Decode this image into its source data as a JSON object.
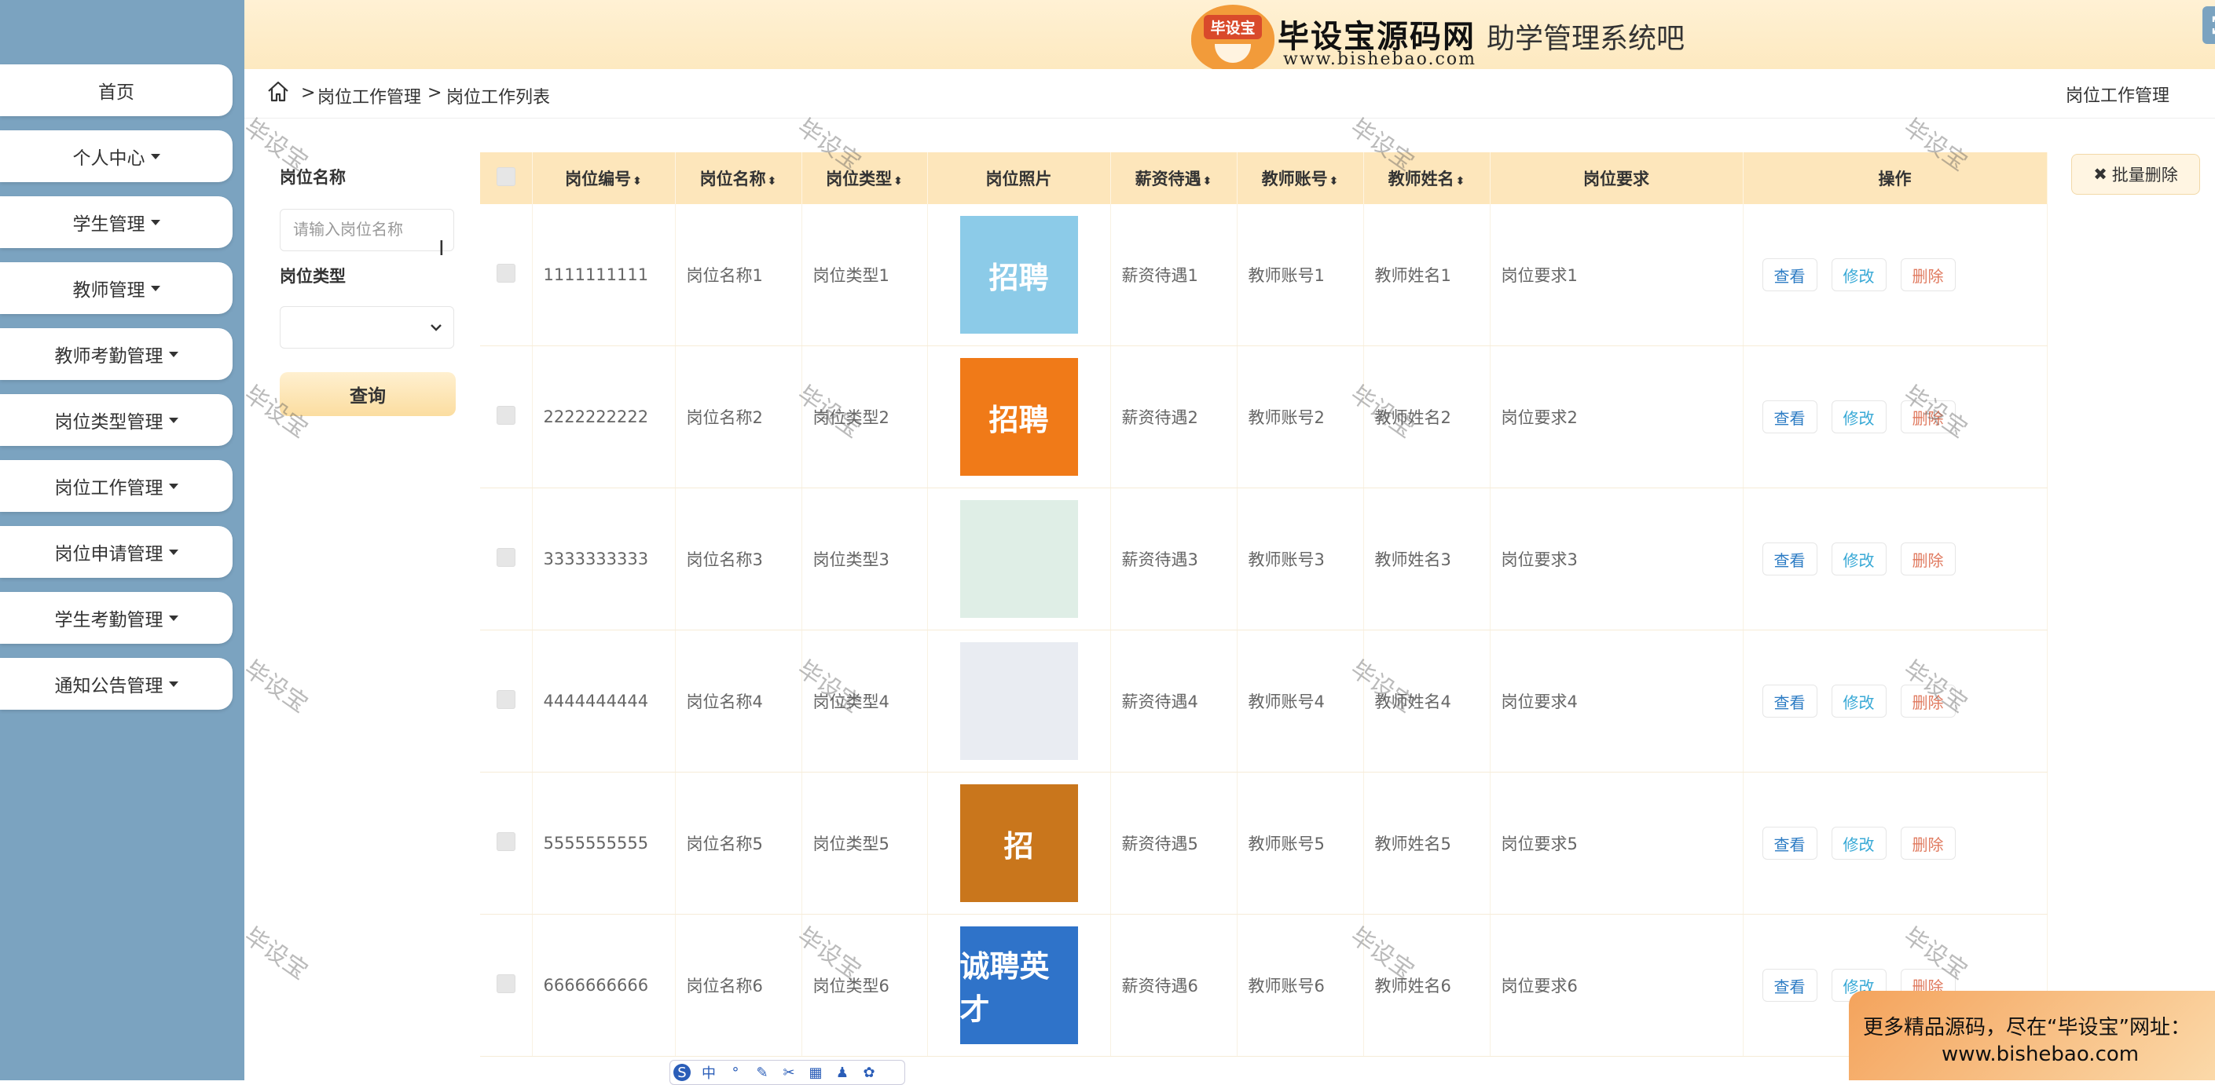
{
  "sidebar": {
    "items": [
      {
        "label": "首页",
        "caret": false
      },
      {
        "label": "个人中心",
        "caret": true
      },
      {
        "label": "学生管理",
        "caret": true
      },
      {
        "label": "教师管理",
        "caret": true
      },
      {
        "label": "教师考勤管理",
        "caret": true
      },
      {
        "label": "岗位类型管理",
        "caret": true
      },
      {
        "label": "岗位工作管理",
        "caret": true
      },
      {
        "label": "岗位申请管理",
        "caret": true
      },
      {
        "label": "学生考勤管理",
        "caret": true
      },
      {
        "label": "通知公告管理",
        "caret": true
      }
    ]
  },
  "header": {
    "logo_badge": "毕设宝",
    "logo_text": "毕设宝源码网",
    "logo_url": "www.bishebao.com",
    "system_title": "助学管理系统吧"
  },
  "breadcrumb": {
    "items": [
      "岗位工作管理",
      "岗位工作列表"
    ],
    "separator": ">",
    "right_title": "岗位工作管理"
  },
  "search": {
    "name_label": "岗位名称",
    "name_placeholder": "请输入岗位名称",
    "type_label": "岗位类型",
    "type_value": "",
    "query_button": "查询"
  },
  "actions": {
    "batch_delete": "批量删除"
  },
  "table": {
    "columns": [
      "岗位编号",
      "岗位名称",
      "岗位类型",
      "岗位照片",
      "薪资待遇",
      "教师账号",
      "教师姓名",
      "岗位要求",
      "操作"
    ],
    "rows": [
      {
        "no": "1111111111",
        "name": "岗位名称1",
        "type": "岗位类型1",
        "salary": "薪资待遇1",
        "teacher_account": "教师账号1",
        "teacher_name": "教师姓名1",
        "requirement": "岗位要求1"
      },
      {
        "no": "2222222222",
        "name": "岗位名称2",
        "type": "岗位类型2",
        "salary": "薪资待遇2",
        "teacher_account": "教师账号2",
        "teacher_name": "教师姓名2",
        "requirement": "岗位要求2"
      },
      {
        "no": "3333333333",
        "name": "岗位名称3",
        "type": "岗位类型3",
        "salary": "薪资待遇3",
        "teacher_account": "教师账号3",
        "teacher_name": "教师姓名3",
        "requirement": "岗位要求3"
      },
      {
        "no": "4444444444",
        "name": "岗位名称4",
        "type": "岗位类型4",
        "salary": "薪资待遇4",
        "teacher_account": "教师账号4",
        "teacher_name": "教师姓名4",
        "requirement": "岗位要求4"
      },
      {
        "no": "5555555555",
        "name": "岗位名称5",
        "type": "岗位类型5",
        "salary": "薪资待遇5",
        "teacher_account": "教师账号5",
        "teacher_name": "教师姓名5",
        "requirement": "岗位要求5"
      },
      {
        "no": "6666666666",
        "name": "岗位名称6",
        "type": "岗位类型6",
        "salary": "薪资待遇6",
        "teacher_account": "教师账号6",
        "teacher_name": "教师姓名6",
        "requirement": "岗位要求6"
      }
    ],
    "photos": [
      {
        "color": "#8ccbe8",
        "text": "招聘"
      },
      {
        "color": "#f07a18",
        "text": "招聘"
      },
      {
        "color": "#dfeee6",
        "text": ""
      },
      {
        "color": "#e9ecf2",
        "text": ""
      },
      {
        "color": "#c9761c",
        "text": "招"
      },
      {
        "color": "#2f73c9",
        "text": "诚聘英才"
      }
    ],
    "op_view": "查看",
    "op_edit": "修改",
    "op_delete": "删除"
  },
  "watermark": "毕设宝",
  "ime": [
    "中"
  ],
  "promo": {
    "line1": "更多精品源码，尽在“毕设宝”网址：",
    "line2": "www.bishebao.com"
  },
  "colors": {
    "sidebar_bg": "#7ba3c0",
    "header_bg": "#fde9c0",
    "table_header_bg": "#fde6bb",
    "view": "#2d7cc4",
    "edit": "#38a9d6",
    "delete": "#e07a5f"
  }
}
